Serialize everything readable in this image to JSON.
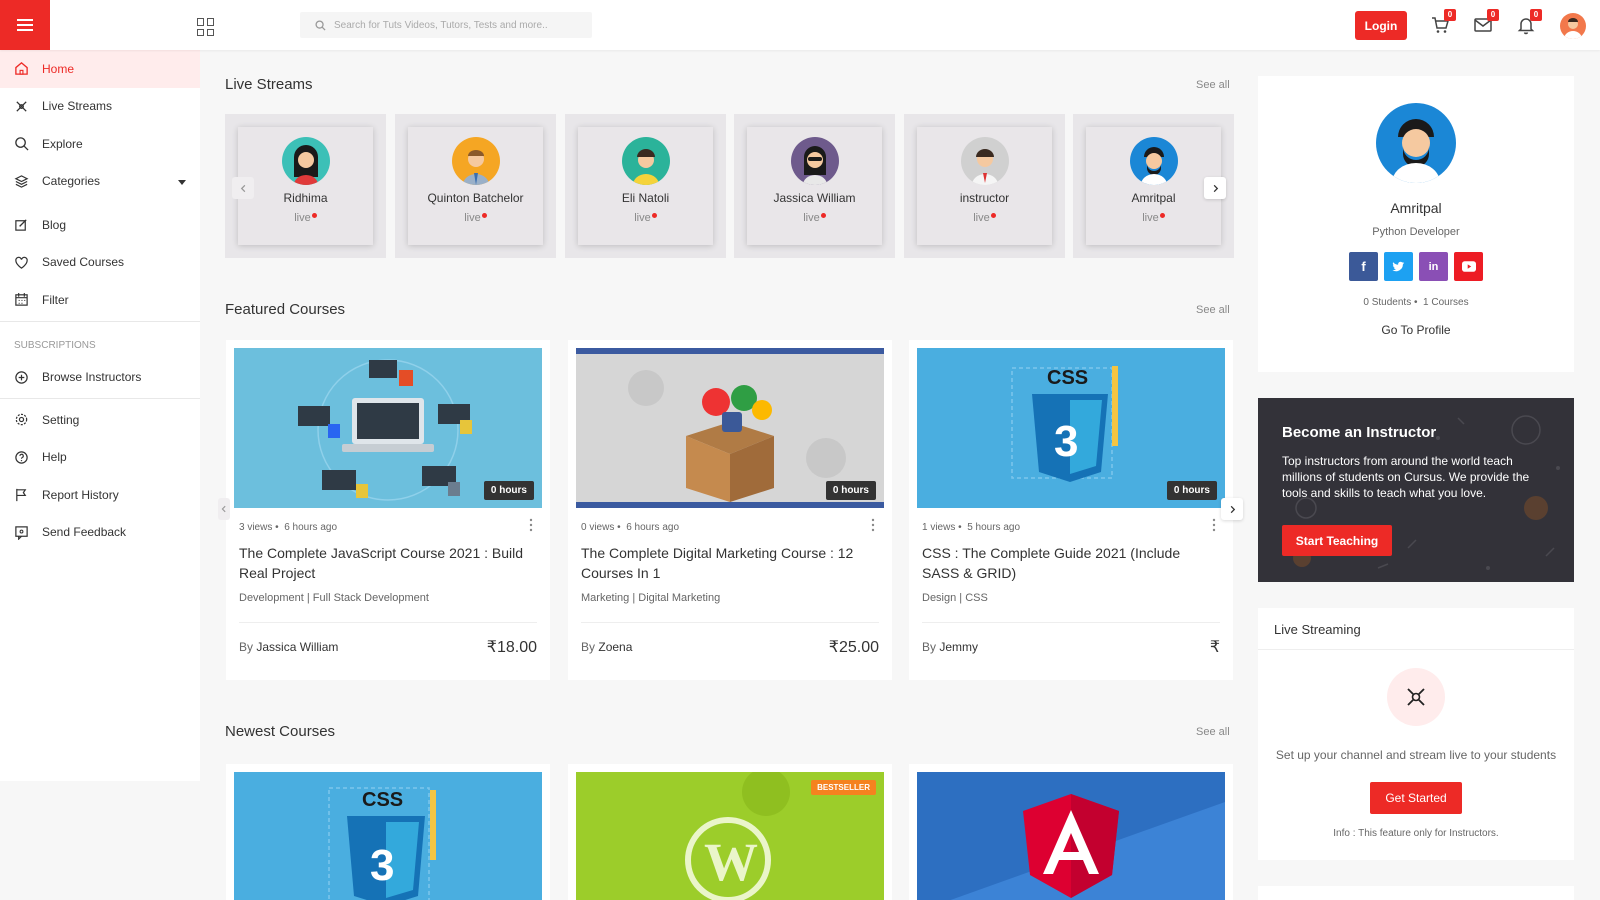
{
  "header": {
    "search_placeholder": "Search for Tuts Videos, Tutors, Tests and more..",
    "login_label": "Login",
    "cart_count": "0",
    "messages_count": "0",
    "notifications_count": "0"
  },
  "sidebar": {
    "items": [
      {
        "label": "Home",
        "icon": "home-icon"
      },
      {
        "label": "Live Streams",
        "icon": "broadcast-icon"
      },
      {
        "label": "Explore",
        "icon": "search-icon"
      },
      {
        "label": "Categories",
        "icon": "layers-icon"
      },
      {
        "label": "Blog",
        "icon": "blog-icon"
      },
      {
        "label": "Saved Courses",
        "icon": "heart-icon"
      },
      {
        "label": "Filter",
        "icon": "filter-icon"
      }
    ],
    "subscriptions_heading": "SUBSCRIPTIONS",
    "browse_instructors": "Browse Instructors",
    "bottom_items": [
      {
        "label": "Setting",
        "icon": "gear-icon"
      },
      {
        "label": "Help",
        "icon": "help-icon"
      },
      {
        "label": "Report History",
        "icon": "flag-icon"
      },
      {
        "label": "Send Feedback",
        "icon": "feedback-icon"
      }
    ]
  },
  "live_streams": {
    "title": "Live Streams",
    "see_all": "See all",
    "live_label": "live",
    "streamers": [
      {
        "name": "Ridhima",
        "color": "#3cc0b7"
      },
      {
        "name": "Quinton Batchelor",
        "color": "#f5a623"
      },
      {
        "name": "Eli Natoli",
        "color": "#2bb39a"
      },
      {
        "name": "Jassica William",
        "color": "#6e5a8c"
      },
      {
        "name": "instructor",
        "color": "#d0d0d0"
      },
      {
        "name": "Amritpal",
        "color": "#1b87d6"
      }
    ]
  },
  "featured": {
    "title": "Featured Courses",
    "see_all": "See all",
    "courses": [
      {
        "hours": "0 hours",
        "views": "3 views",
        "time": "6 hours ago",
        "title": "The Complete JavaScript Course 2021 : Build Real Project",
        "category": "Development | Full Stack Development",
        "by_label": "By",
        "author": "Jassica William",
        "price": "₹18.00"
      },
      {
        "hours": "0 hours",
        "views": "0 views",
        "time": "6 hours ago",
        "title": "The Complete Digital Marketing Course : 12 Courses In 1",
        "category": "Marketing | Digital Marketing",
        "by_label": "By",
        "author": "Zoena",
        "price": "₹25.00"
      },
      {
        "hours": "0 hours",
        "views": "1 views",
        "time": "5 hours ago",
        "title": "CSS : The Complete Guide 2021 (Include SASS & GRID)",
        "category": "Design | CSS",
        "by_label": "By",
        "author": "Jemmy",
        "price": "₹"
      }
    ]
  },
  "newest": {
    "title": "Newest Courses",
    "see_all": "See all",
    "bestseller": "BESTSELLER"
  },
  "profile": {
    "name": "Amritpal",
    "role": "Python Developer",
    "students": "0 Students",
    "courses": "1 Courses",
    "link": "Go To Profile",
    "social_colors": {
      "facebook": "#3b5998",
      "twitter": "#1da1f2",
      "linkedin": "#8a4fb5",
      "youtube": "#ed1c24"
    }
  },
  "instructor_promo": {
    "title": "Become an Instructor",
    "text": "Top instructors from around the world teach millions of students on Cursus. We provide the tools and skills to teach what you love.",
    "button": "Start Teaching"
  },
  "live_streaming": {
    "title": "Live Streaming",
    "description": "Set up your channel and stream live to your students",
    "button": "Get Started",
    "info": "Info : This feature only for Instructors."
  },
  "colors": {
    "accent": "#ed2a26",
    "active_bg": "#ffecec"
  }
}
